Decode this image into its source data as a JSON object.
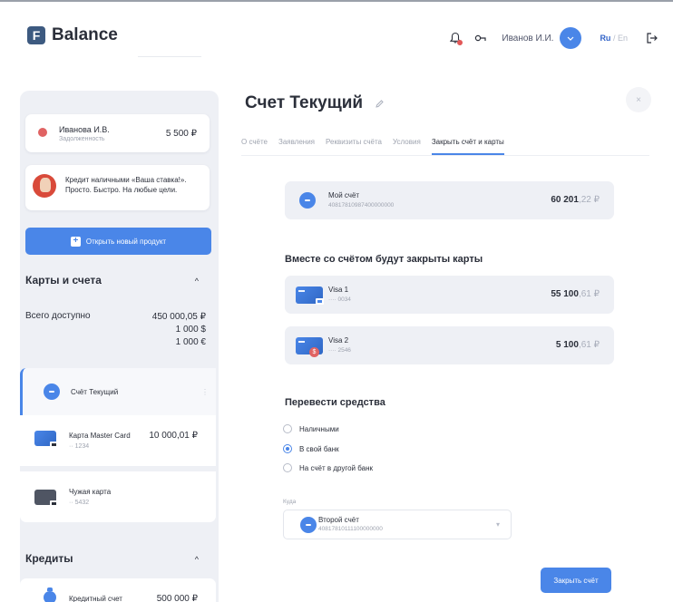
{
  "header": {
    "logo_letter": "F",
    "app_title": "Balance",
    "user_name": "Иванов И.И.",
    "lang_active": "Ru",
    "lang_separator": "/",
    "lang_inactive": "En",
    "icons": [
      "bell-icon",
      "infinity-icon",
      "chevron-down-icon",
      "logout-icon"
    ],
    "accent_color": "#4a86e8",
    "notification_color": "#e25858"
  },
  "sidebar": {
    "debt": {
      "name": "Иванова И.В.",
      "subtitle": "Задолженность",
      "amount": "5 500 ₽"
    },
    "promo": {
      "text": "Кредит наличными «Ваша ставка!». Просто. Быстро. На любые цели."
    },
    "open_button": {
      "plus": "+",
      "label": "Открыть новый продукт"
    },
    "cards_section": {
      "title": "Карты и счета",
      "chevron": "^",
      "available_label": "Всего доступно",
      "available_values": [
        "450 000,05 ₽",
        "1 000 $",
        "1 000 €"
      ]
    },
    "accounts": [
      {
        "name": "Счёт Текущий",
        "kebab": "⋮"
      },
      {
        "name": "Карта Master Card",
        "number": "·· 1234",
        "amount": "10 000,01 ₽"
      },
      {
        "name": "Чужая карта",
        "number": "·· 5432"
      }
    ],
    "credits_section": {
      "title": "Кредиты",
      "chevron": "^"
    },
    "credit": {
      "name": "Кредитный счет",
      "amount": "500 000 ₽"
    }
  },
  "main": {
    "title": "Счет Текущий",
    "close_symbol": "×",
    "tabs": [
      "О счёте",
      "Заявления",
      "Реквизиты счёта",
      "Условия",
      "Закрыть счёт и карты"
    ],
    "my_account": {
      "name": "Мой счёт",
      "number": "40817810987400000000",
      "amount_int": "60 201",
      "amount_frac": ",22",
      "currency": "₽"
    },
    "cards_heading": "Вместе со счётом будут закрыты карты",
    "cards": [
      {
        "name": "Visa 1",
        "number": "···· 0034",
        "amount_int": "55 100",
        "amount_frac": ",61",
        "currency": "₽"
      },
      {
        "name": "Visa 2",
        "number": "···· 2546",
        "amount_int": "5 100",
        "amount_frac": ",61",
        "currency": "₽",
        "badge": "$"
      }
    ],
    "transfer_heading": "Перевести средства",
    "radio_options": [
      "Наличными",
      "В свой банк",
      "На счёт в другой банк"
    ],
    "radio_selected_index": 1,
    "to_label": "Куда",
    "target_account": {
      "name": "Второй счёт",
      "number": "40817810111100000000"
    },
    "close_button": "Закрыть счёт"
  }
}
